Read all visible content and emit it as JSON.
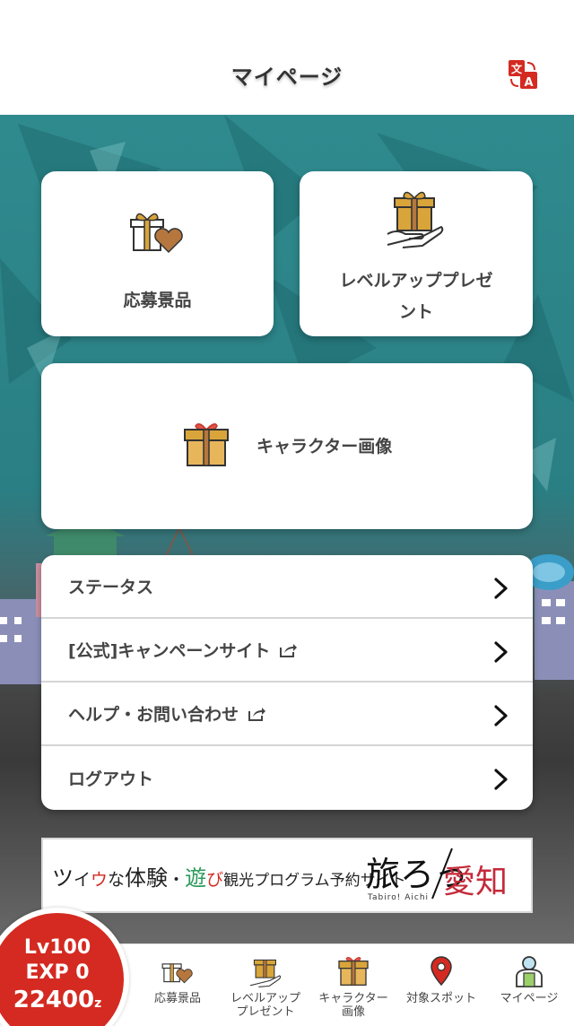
{
  "header": {
    "title": "マイページ",
    "translate_icon": "translate-icon"
  },
  "cards": {
    "prize": {
      "label": "応募景品",
      "icon": "gift-heart-icon"
    },
    "levelup": {
      "label_line1": "レベルアッププレゼ",
      "label_line2": "ント",
      "icon": "gift-hand-icon"
    },
    "character": {
      "label": "キャラクター画像",
      "icon": "gift-box-icon"
    }
  },
  "menu": {
    "items": [
      {
        "label": "ステータス",
        "external": false
      },
      {
        "label": "[公式]キャンペーンサイト",
        "external": true
      },
      {
        "label": "ヘルプ・お問い合わせ",
        "external": true
      },
      {
        "label": "ログアウト",
        "external": false
      }
    ]
  },
  "banner": {
    "text_a": "ツ",
    "text_b": "イ",
    "text_c": "ウ",
    "text_d": "な",
    "text_e": "体験",
    "text_f": "・",
    "text_g": "遊",
    "text_h": "び",
    "text_i": "観光プログラム予約サイト",
    "logo_main": "旅ろっ",
    "logo_aichi": "愛知",
    "logo_sub": "Tabiro! Aichi"
  },
  "level": {
    "lv": "Lv100",
    "exp": "EXP 0",
    "points": "22400",
    "unit": "z"
  },
  "tabs": [
    {
      "line1": "応募景品",
      "line2": "",
      "icon": "gift-heart-icon"
    },
    {
      "line1": "レベルアップ",
      "line2": "プレゼント",
      "icon": "gift-hand-icon"
    },
    {
      "line1": "キャラクター",
      "line2": "画像",
      "icon": "gift-box-icon"
    },
    {
      "line1": "対象スポット",
      "line2": "",
      "icon": "map-pin-icon"
    },
    {
      "line1": "マイページ",
      "line2": "",
      "icon": "person-icon"
    }
  ],
  "colors": {
    "accent": "#d42a21",
    "teal": "#2a7f84",
    "gold": "#d9a53a"
  }
}
